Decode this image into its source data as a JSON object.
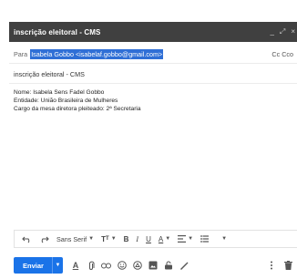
{
  "window": {
    "title": "inscrição eleitoral - CMS",
    "controls": {
      "minimize": "_",
      "expand": "⤢",
      "close": "×"
    }
  },
  "recipients": {
    "to_label": "Para",
    "to_value": "Isabela Gobbo <isabelaf.gobbo@gmail.com>",
    "cc_label": "Cc Cco"
  },
  "subject": "inscrição eleitoral - CMS",
  "body": {
    "lines": [
      "Nome: Isabela Sens Fadel Gobbo",
      "Entidade: União Brasileira de Mulheres",
      "Cargo da mesa diretora pleiteado: 2ª Secretaria"
    ]
  },
  "format_toolbar": {
    "font_name": "Sans Serif",
    "icons": [
      "undo-icon",
      "redo-icon",
      "font-size-icon",
      "bold-icon",
      "italic-icon",
      "underline-icon",
      "text-color-icon",
      "align-icon",
      "list-icon",
      "more-format-icon"
    ]
  },
  "bottom_bar": {
    "send_label": "Enviar",
    "icons": [
      "formatting-icon",
      "attach-icon",
      "link-icon",
      "emoji-icon",
      "drive-icon",
      "photo-icon",
      "confidential-icon",
      "signature-icon",
      "more-options-icon",
      "trash-icon"
    ],
    "colors": {
      "send": "#1a73e8",
      "titlebar": "#404040",
      "selection": "#2f6fd6"
    }
  }
}
